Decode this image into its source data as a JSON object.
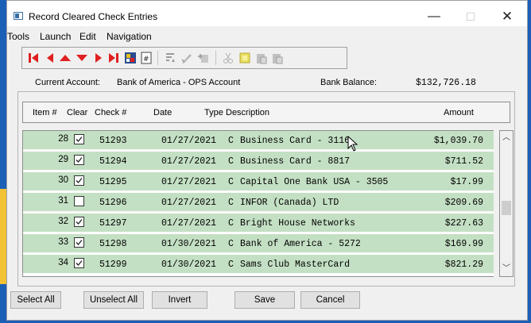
{
  "window": {
    "title": "Record Cleared Check Entries"
  },
  "menu": [
    "Tools",
    "Launch",
    "Edit",
    "Navigation"
  ],
  "toolbar": {
    "icons": [
      "first-record-icon",
      "previous-record-icon",
      "up-icon",
      "down-icon",
      "next-record-icon",
      "last-record-icon",
      "print-icon",
      "calculator-icon",
      "sort-icon",
      "edit-icon",
      "attach-icon",
      "cut-icon",
      "copy-icon",
      "paste-icon",
      "paste-special-icon"
    ]
  },
  "account": {
    "current_label": "Current Account:",
    "current_value": "Bank of America - OPS Account",
    "balance_label": "Bank Balance:",
    "balance_value": "$132,726.18"
  },
  "table": {
    "headers": {
      "item": "Item #",
      "clear": "Clear",
      "check": "Check #",
      "date": "Date",
      "type": "Type",
      "description": "Description",
      "amount": "Amount"
    },
    "rows": [
      {
        "item": "28",
        "cleared": true,
        "check": "51293",
        "date": "01/27/2021",
        "type": "C",
        "description": "Business Card - 3116",
        "amount": "$1,039.70"
      },
      {
        "item": "29",
        "cleared": true,
        "check": "51294",
        "date": "01/27/2021",
        "type": "C",
        "description": "Business Card - 8817",
        "amount": "$711.52"
      },
      {
        "item": "30",
        "cleared": true,
        "check": "51295",
        "date": "01/27/2021",
        "type": "C",
        "description": "Capital One Bank USA - 3505",
        "amount": "$17.99"
      },
      {
        "item": "31",
        "cleared": false,
        "check": "51296",
        "date": "01/27/2021",
        "type": "C",
        "description": "INFOR (Canada) LTD",
        "amount": "$209.69"
      },
      {
        "item": "32",
        "cleared": true,
        "check": "51297",
        "date": "01/27/2021",
        "type": "C",
        "description": "Bright House Networks",
        "amount": "$227.63"
      },
      {
        "item": "33",
        "cleared": true,
        "check": "51298",
        "date": "01/30/2021",
        "type": "C",
        "description": "Bank of America - 5272",
        "amount": "$169.99"
      },
      {
        "item": "34",
        "cleared": true,
        "check": "51299",
        "date": "01/30/2021",
        "type": "C",
        "description": "Sams Club MasterCard",
        "amount": "$821.29"
      }
    ]
  },
  "buttons": {
    "select_all": "Select All",
    "unselect_all": "Unselect All",
    "invert": "Invert",
    "save": "Save",
    "cancel": "Cancel"
  },
  "colors": {
    "row_bg": "#c4e0c4",
    "accent_red": "#e02020",
    "desktop": "#1b5fb7"
  }
}
